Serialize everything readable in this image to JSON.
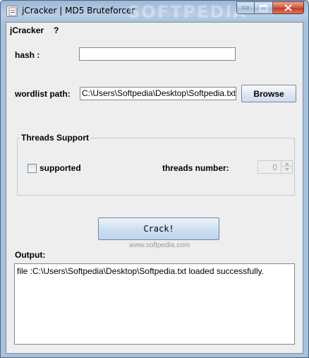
{
  "window": {
    "title": "jCracker | MD5 Bruteforcer",
    "watermark": "SOFTPEDIA"
  },
  "menu": {
    "items": [
      "jCracker",
      "?"
    ]
  },
  "hash": {
    "label": "hash :",
    "value": ""
  },
  "wordlist": {
    "label": "wordlist path:",
    "value": "C:\\Users\\Softpedia\\Desktop\\Softpedia.txt",
    "browse_label": "Browse"
  },
  "threads": {
    "group_title": "Threads Support",
    "supported_label": "supported",
    "supported_checked": false,
    "number_label": "threads number:",
    "number_value": "0"
  },
  "crack": {
    "label": "Crack!",
    "overlay_watermark": "www.softpedia.com"
  },
  "output": {
    "label": "Output:",
    "text": "file :C:\\Users\\Softpedia\\Desktop\\Softpedia.txt loaded successfully."
  }
}
